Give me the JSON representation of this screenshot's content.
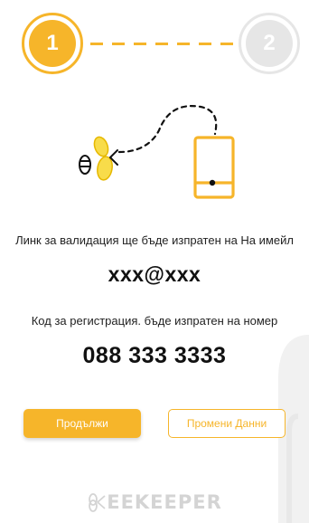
{
  "stepper": {
    "step1": "1",
    "step2": "2",
    "active_color": "#f6b52a",
    "inactive_color": "#e6e6e6"
  },
  "illustration": {
    "bee_icon": "bee-icon",
    "phone_icon": "phone-icon"
  },
  "email_section": {
    "info": "Линк за валидация ще бъде изпратен на На имейл",
    "value": "xxx@xxx"
  },
  "phone_section": {
    "info": "Код за регистрация. бъде изпратен на номер",
    "value": "088 333  3333"
  },
  "actions": {
    "continue_label": "Продължи",
    "edit_label": "Промени Данни"
  },
  "footer": {
    "logo_text": "EEKEEPER"
  },
  "colors": {
    "accent": "#f6b52a",
    "text": "#111111",
    "muted": "#d4d4d4"
  }
}
